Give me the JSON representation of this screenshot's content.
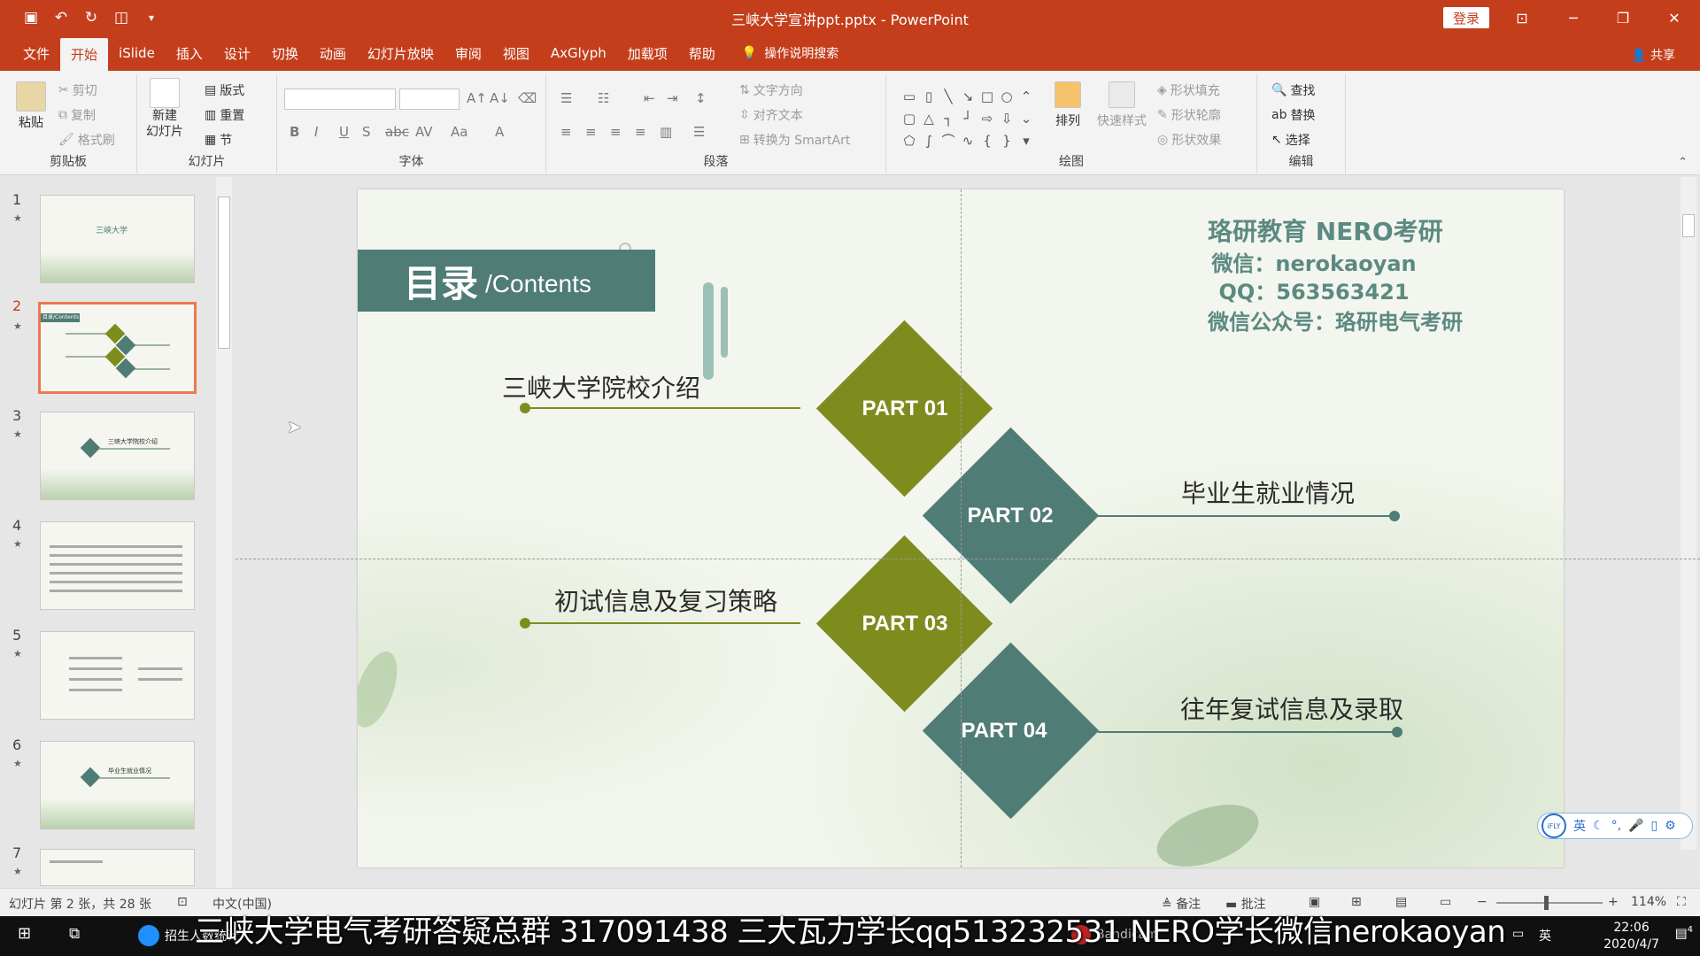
{
  "window": {
    "title": "三峡大学宣讲ppt.pptx - PowerPoint",
    "login": "登录"
  },
  "tabs": [
    "文件",
    "开始",
    "iSlide",
    "插入",
    "设计",
    "切换",
    "动画",
    "幻灯片放映",
    "审阅",
    "视图",
    "AxGlyph",
    "加载项",
    "帮助"
  ],
  "tell_me": "操作说明搜索",
  "share": "共享",
  "ribbon": {
    "clipboard": {
      "label": "剪贴板",
      "paste": "粘贴",
      "cut": "剪切",
      "copy": "复制",
      "format_painter": "格式刷"
    },
    "slides": {
      "label": "幻灯片",
      "new_slide": "新建",
      "new_slide2": "幻灯片",
      "layout": "版式",
      "reset": "重置",
      "section": "节"
    },
    "font": {
      "label": "字体"
    },
    "paragraph": {
      "label": "段落",
      "text_direction": "文字方向",
      "align_text": "对齐文本",
      "smartart": "转换为 SmartArt"
    },
    "drawing": {
      "label": "绘图",
      "arrange": "排列",
      "quick_styles": "快速样式",
      "shape_fill": "形状填充",
      "shape_outline": "形状轮廓",
      "shape_effects": "形状效果"
    },
    "editing": {
      "label": "编辑",
      "find": "查找",
      "replace": "替换",
      "select": "选择"
    }
  },
  "thumbnails": [
    {
      "num": "1",
      "text": "三峡大学"
    },
    {
      "num": "2",
      "text": "目录/Contents"
    },
    {
      "num": "3",
      "text": "三峡大学院校介绍"
    },
    {
      "num": "4",
      "text": ""
    },
    {
      "num": "5",
      "text": ""
    },
    {
      "num": "6",
      "text": "毕业生就业情况"
    },
    {
      "num": "7",
      "text": ""
    }
  ],
  "slide": {
    "contents_main": "目录",
    "contents_sub": "/Contents",
    "parts": [
      {
        "label": "PART 01",
        "text": "三峡大学院校介绍",
        "color": "#7e8c1e"
      },
      {
        "label": "PART 02",
        "text": "毕业生就业情况",
        "color": "#4f7c74"
      },
      {
        "label": "PART 03",
        "text": "初试信息及复习策略",
        "color": "#7e8c1e"
      },
      {
        "label": "PART 04",
        "text": "往年复试信息及录取",
        "color": "#4f7c74"
      }
    ],
    "brand": {
      "line1": "珞研教育 NERO考研",
      "line2": "微信：nerokaoyan",
      "line3": "QQ：563563421",
      "line4": "微信公众号：珞研电气考研"
    }
  },
  "status": {
    "slide_info": "幻灯片 第 2 张，共 28 张",
    "language": "中文(中国)",
    "notes": "备注",
    "comments": "批注",
    "zoom": "114%"
  },
  "subtitle": "三峡大学电气考研答疑总群 317091438 三大瓦力学长qq513232531 NERO学长微信nerokaoyan",
  "taskbar": {
    "app1": "招生人数统计",
    "app2": "Bandicam",
    "ime": "英",
    "time": "22:06",
    "date": "2020/4/7",
    "notifications": "4"
  },
  "colors": {
    "accent": "#c43e1c",
    "olive": "#7e8c1e",
    "teal": "#4f7c74"
  }
}
